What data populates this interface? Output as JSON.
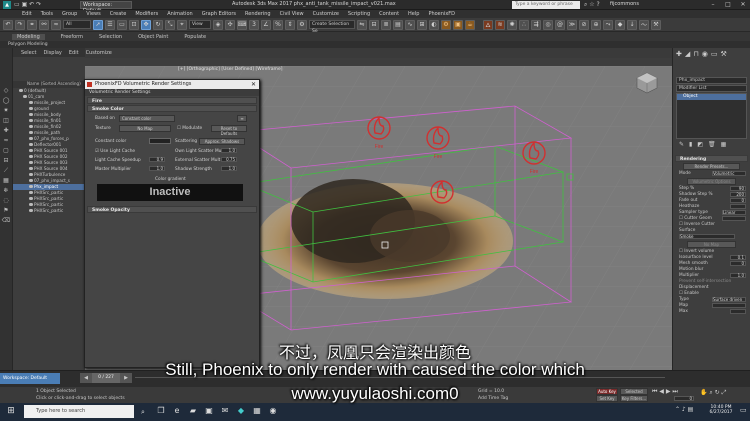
{
  "window": {
    "workspace": "Workspace: Default",
    "title": "Autodesk 3ds Max 2017    phx_anti_tank_missile_impact_v021.max",
    "search_placeholder": "Type a keyword or phrase",
    "user": "fijcommons"
  },
  "menu": [
    "Edit",
    "Tools",
    "Group",
    "Views",
    "Create",
    "Modifiers",
    "Animation",
    "Graph Editors",
    "Rendering",
    "Civil View",
    "Customize",
    "Scripting",
    "Content",
    "Help",
    "PhoenixFD"
  ],
  "toolbar": {
    "filter": "All",
    "view": "View",
    "selection_set": "Create Selection Se"
  },
  "ribbon": {
    "tabs": [
      "Modeling",
      "Freeform",
      "Selection",
      "Object Paint",
      "Populate"
    ],
    "panel": "Polygon Modeling"
  },
  "scene_explorer": {
    "tabs": [
      "Select",
      "Display",
      "Edit",
      "Customize"
    ],
    "header": "Name (Sorted Ascending)",
    "items": [
      {
        "label": "0 (default)",
        "sel": false
      },
      {
        "label": "01_cam",
        "sel": false
      },
      {
        "label": "missile_project",
        "sel": false
      },
      {
        "label": "ground",
        "sel": false
      },
      {
        "label": "missile_body",
        "sel": false
      },
      {
        "label": "missile_fin01",
        "sel": false
      },
      {
        "label": "missile_fin02",
        "sel": false
      },
      {
        "label": "missile_path",
        "sel": false
      },
      {
        "label": "07_phx_forces_p",
        "sel": false
      },
      {
        "label": "Deflector001",
        "sel": false
      },
      {
        "label": "PHX Source 001",
        "sel": false
      },
      {
        "label": "PHX Source 002",
        "sel": false
      },
      {
        "label": "PHX Source 003",
        "sel": false
      },
      {
        "label": "PHX Source 004",
        "sel": false
      },
      {
        "label": "PHXTurbulence",
        "sel": false
      },
      {
        "label": "07_phx_impact_s",
        "sel": false
      },
      {
        "label": "Phx_impact",
        "sel": true
      },
      {
        "label": "PHXSrc_partic",
        "sel": false
      },
      {
        "label": "PHXSrc_partic",
        "sel": false
      },
      {
        "label": "PHXSrc_partic",
        "sel": false
      },
      {
        "label": "PHXSrc_partic",
        "sel": false
      }
    ]
  },
  "viewport": {
    "label": "[+] [Orthographic] [User Defined] [Wireframe]",
    "fire_label": "Fire"
  },
  "dialog": {
    "title": "PhoenixFD Volumetric Render Settings",
    "subtitle": "Volumetric Render Settings",
    "fire_rollup": "Fire",
    "smoke_color_rollup": "Smoke Color",
    "based_on_label": "Based on",
    "based_on_value": "Constant color",
    "texture_label": "Texture",
    "texture_value": "No Map",
    "modulate_label": "Modulate",
    "reset_label": "Reset to Defaults",
    "constant_color_label": "Constant color",
    "scattering_label": "Scattering",
    "scattering_value": "Approx. Shadows",
    "use_light_cache_label": "Use Light Cache",
    "own_light_label": "Own Light Scatter Mult",
    "own_light_value": "1.0",
    "light_cache_speedup_label": "Light Cache Speedup",
    "light_cache_speedup_value": "0.9",
    "external_scatter_label": "External Scatter Mult",
    "external_scatter_value": "0.75",
    "master_multiplier_label": "Master Multiplier",
    "master_multiplier_value": "1.0",
    "shadow_strength_label": "Shadow Strength",
    "shadow_strength_value": "1.0",
    "color_gradient_label": "Color gradient",
    "inactive_label": "Inactive",
    "smoke_opacity_rollup": "Smoke Opacity"
  },
  "command_panel": {
    "object_name": "Phx_impact",
    "modifier_list": "Modifier List",
    "stack_item": "Object",
    "rendering_rollup": "Rendering",
    "render_presets": "Render Presets...",
    "mode_label": "Mode",
    "mode_value": "Volumetric",
    "vol_options": "Volumetric Options",
    "params": [
      {
        "label": "Step %",
        "value": "90"
      },
      {
        "label": "Shadow Step %",
        "value": "200"
      },
      {
        "label": "Fade out",
        "value": "0"
      },
      {
        "label": "Heathaze",
        "value": ""
      }
    ],
    "sampler_label": "Sampler type",
    "sampler_value": "Linear",
    "cutter_geom": "Cutter Geom",
    "inverse_cutter": "Inverse Cutter",
    "surface_label": "Surface",
    "smoke_label": "Smoke",
    "no_map": "No Map",
    "invert_volume": "Invert volume",
    "isosurface_label": "Isosurface level",
    "isosurface_value": "0.1",
    "mesh_smooth_label": "Mesh smooth",
    "mesh_smooth_value": "0",
    "motion_blur_label": "Motion blur",
    "multiplier_label": "Multiplier",
    "multiplier_value": "1.0",
    "prevent_self": "Prevent self-intersection",
    "displacement_label": "Displacement",
    "enable_label": "Enable",
    "type_label": "Type",
    "type_value": "Surface driven",
    "map_label": "Map",
    "max_label": "Max"
  },
  "status": {
    "workspace": "Workspace: Default",
    "selected": "1 Object Selected",
    "hint": "Click or click-and-drag to select objects",
    "grid": "Grid = 10.0",
    "autokey": "Auto Key",
    "selected_btn": "Selected",
    "setkey": "Set Key",
    "key_filters": "Key Filters...",
    "add_time_tag": "Add Time Tag",
    "frame": "0",
    "frame_total": "227"
  },
  "taskbar": {
    "search": "Type here to search",
    "time": "10:40 PM",
    "date": "6/27/2017"
  },
  "subtitles": {
    "zh": "不过，凤凰只会渲染出颜色",
    "en": "Still, Phoenix to only render with caused the color which",
    "url": "www.yuyulaoshi.com0"
  },
  "colors": {
    "accent": "#4a7db5",
    "fire_icon": "#d13030",
    "box_magenta": "#d060d0",
    "box_green": "#40c040"
  }
}
